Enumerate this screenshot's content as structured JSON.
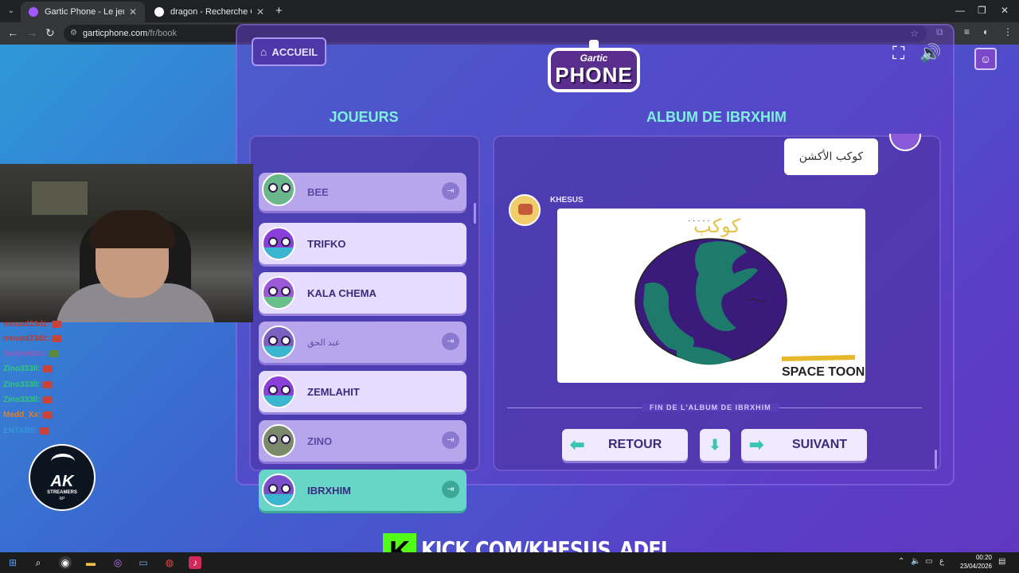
{
  "browser": {
    "tabs": [
      {
        "title": "Gartic Phone - Le jeu du téléph",
        "active": true
      },
      {
        "title": "dragon - Recherche Google",
        "active": false
      }
    ],
    "url_host": "garticphone.com",
    "url_path": "/fr/book"
  },
  "game": {
    "home_label": "ACCUEIL",
    "logo_top": "Gartic",
    "logo_main": "PHONE",
    "players_heading": "JOUEURS",
    "album_heading": "ALBUM DE IBRXHIM",
    "players": [
      {
        "name": "BEE",
        "state": "off"
      },
      {
        "name": "TRIFKO",
        "state": "on"
      },
      {
        "name": "KALA CHEMA",
        "state": "on"
      },
      {
        "name": "عبد الحق",
        "state": "off"
      },
      {
        "name": "ZEMLAHIT",
        "state": "on"
      },
      {
        "name": "ZINO",
        "state": "off"
      },
      {
        "name": "IBRXHIM",
        "state": "me"
      }
    ],
    "prompt_bubble": "كوكب الأكشن",
    "author": "KHESUS",
    "drawing_text_arabic": "كوكب",
    "drawing_caption": "SPACE TOON",
    "end_label": "FIN DE L'ALBUM DE IBRXHIM",
    "back_label": "RETOUR",
    "next_label": "SUIVANT"
  },
  "stream": {
    "chat": [
      {
        "user": "mouad23dz:",
        "color": "#c0392b"
      },
      {
        "user": "mouad23dz:",
        "color": "#c0392b"
      },
      {
        "user": "IlsAyoubzz:",
        "color": "#9b59b6"
      },
      {
        "user": "Zino333ll:",
        "color": "#2ecc71"
      },
      {
        "user": "Zino333ll:",
        "color": "#2ecc71"
      },
      {
        "user": "Zino333ll:",
        "color": "#2ecc71"
      },
      {
        "user": "Medd_Xx:",
        "color": "#e67e22"
      },
      {
        "user": "ENTARII:",
        "color": "#3498db"
      }
    ],
    "ak_logo_big": "AK",
    "ak_logo_small": "STREAMERS",
    "ak_logo_tiny": "RP",
    "kick_url": "KICK.COM/KHESUS_ADEL"
  },
  "taskbar": {
    "time": "00:20",
    "date": "23/04/2026"
  },
  "colors": {
    "accent_teal": "#7ff0e0",
    "card_purple": "#603cc4",
    "kick_green": "#53fc18"
  }
}
